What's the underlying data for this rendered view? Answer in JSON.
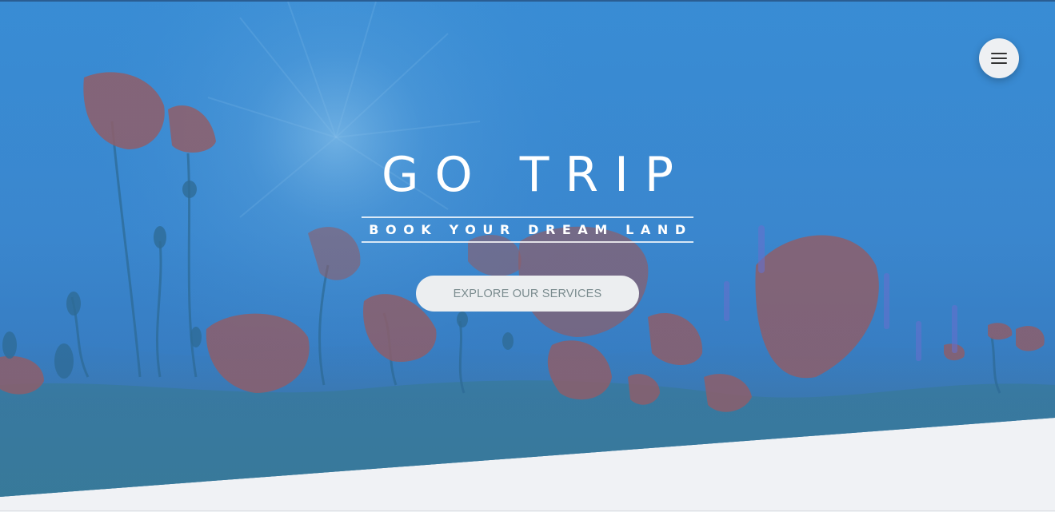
{
  "hero": {
    "title": "GO TRIP",
    "tagline": "BOOK YOUR DREAM LAND",
    "cta_label": "EXPLORE OUR SERVICES",
    "background_image": "sunlit-poppy-field-sky-photo",
    "tint_color": "#3a8ad2"
  },
  "menu": {
    "icon": "hamburger-menu-icon"
  },
  "colors": {
    "hero_blue": "#3b8fd6",
    "page_bg": "#f0f2f5",
    "button_bg": "#eceef0",
    "button_text": "#7b8c8f"
  }
}
